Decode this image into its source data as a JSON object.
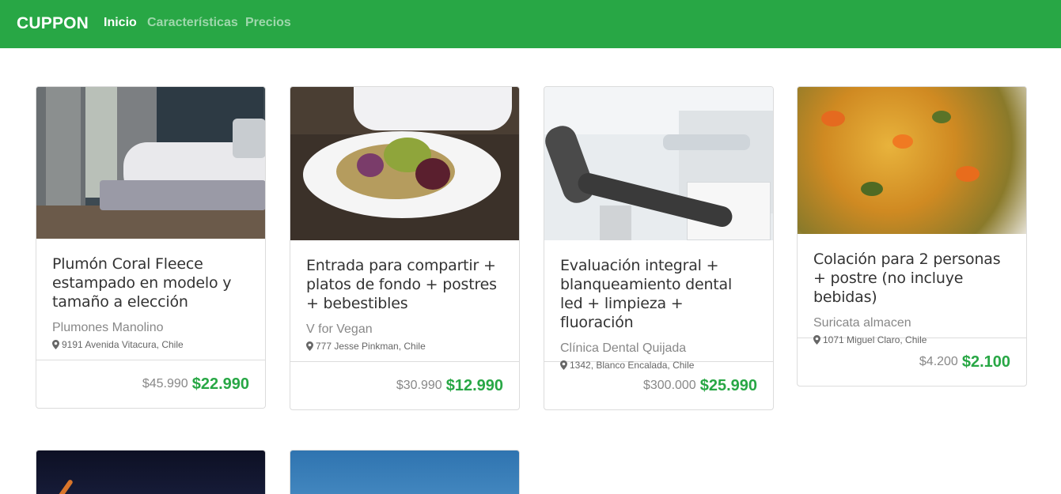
{
  "nav": {
    "brand": "CUPPON",
    "links": [
      {
        "label": "Inicio",
        "active": true
      },
      {
        "label": "Características",
        "active": false
      },
      {
        "label": "Precios",
        "active": false
      }
    ]
  },
  "colors": {
    "accent": "#28a745"
  },
  "cards": [
    {
      "title": "Plumón Coral Fleece estampado en modelo y tamaño a elección",
      "merchant": "Plumones Manolino",
      "address": "9191 Avenida Vitacura, Chile",
      "old_price": "$45.990",
      "new_price": "$22.990",
      "image": "bedroom-photo"
    },
    {
      "title": "Entrada para compartir + platos de fondo + postres + bebestibles",
      "merchant": "V for Vegan",
      "address": "777 Jesse Pinkman, Chile",
      "old_price": "$30.990",
      "new_price": "$12.990",
      "image": "vegan-salad-photo"
    },
    {
      "title": "Evaluación integral + blanqueamiento dental led + limpieza + fluoración",
      "merchant": "Clínica Dental Quijada",
      "address": "1342, Blanco Encalada, Chile",
      "old_price": "$300.000",
      "new_price": "$25.990",
      "image": "dental-clinic-photo"
    },
    {
      "title": "Colación para 2 personas + postre (no incluye bebidas)",
      "merchant": "Suricata almacen",
      "address": "1071 Miguel Claro, Chile",
      "old_price": "$4.200",
      "new_price": "$2.100",
      "image": "food-dish-photo"
    }
  ],
  "second_row_images": [
    "night-sky-photo",
    "blue-sky-photo"
  ],
  "icons": {
    "address": "map-marker-icon"
  }
}
